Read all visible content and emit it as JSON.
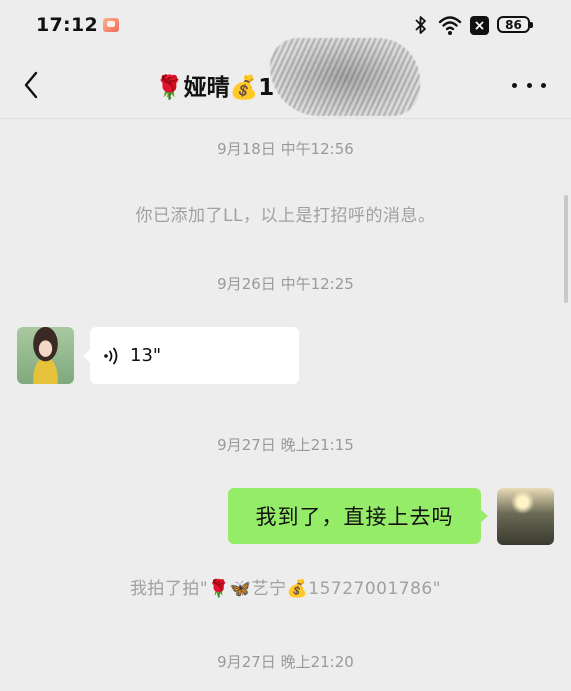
{
  "status_bar": {
    "time": "17:12",
    "battery_level": "86",
    "icons": [
      "app-notification-icon",
      "bluetooth-icon",
      "wifi-icon",
      "close-box-icon",
      "battery-icon"
    ]
  },
  "header": {
    "title": "🌹娅晴💰1",
    "back_icon": "chevron-left-icon",
    "more_icon": "more-dots-icon"
  },
  "messages": [
    {
      "type": "timestamp",
      "text": "9月18日 中午12:56"
    },
    {
      "type": "system",
      "text": "你已添加了LL，以上是打招呼的消息。"
    },
    {
      "type": "timestamp",
      "text": "9月26日 中午12:25"
    },
    {
      "type": "voice",
      "direction": "incoming",
      "duration": "13\""
    },
    {
      "type": "timestamp",
      "text": "9月27日 晚上21:15"
    },
    {
      "type": "text",
      "direction": "outgoing",
      "text": "我到了，直接上去吗"
    },
    {
      "type": "system",
      "text": "我拍了拍\"🌹🦋艺宁💰15727001786\""
    },
    {
      "type": "timestamp",
      "text": "9月27日 晚上21:20"
    }
  ],
  "colors": {
    "background": "#ededed",
    "outgoing_bubble": "#95ec69",
    "incoming_bubble": "#ffffff",
    "timestamp_text": "#9a9a9a"
  }
}
